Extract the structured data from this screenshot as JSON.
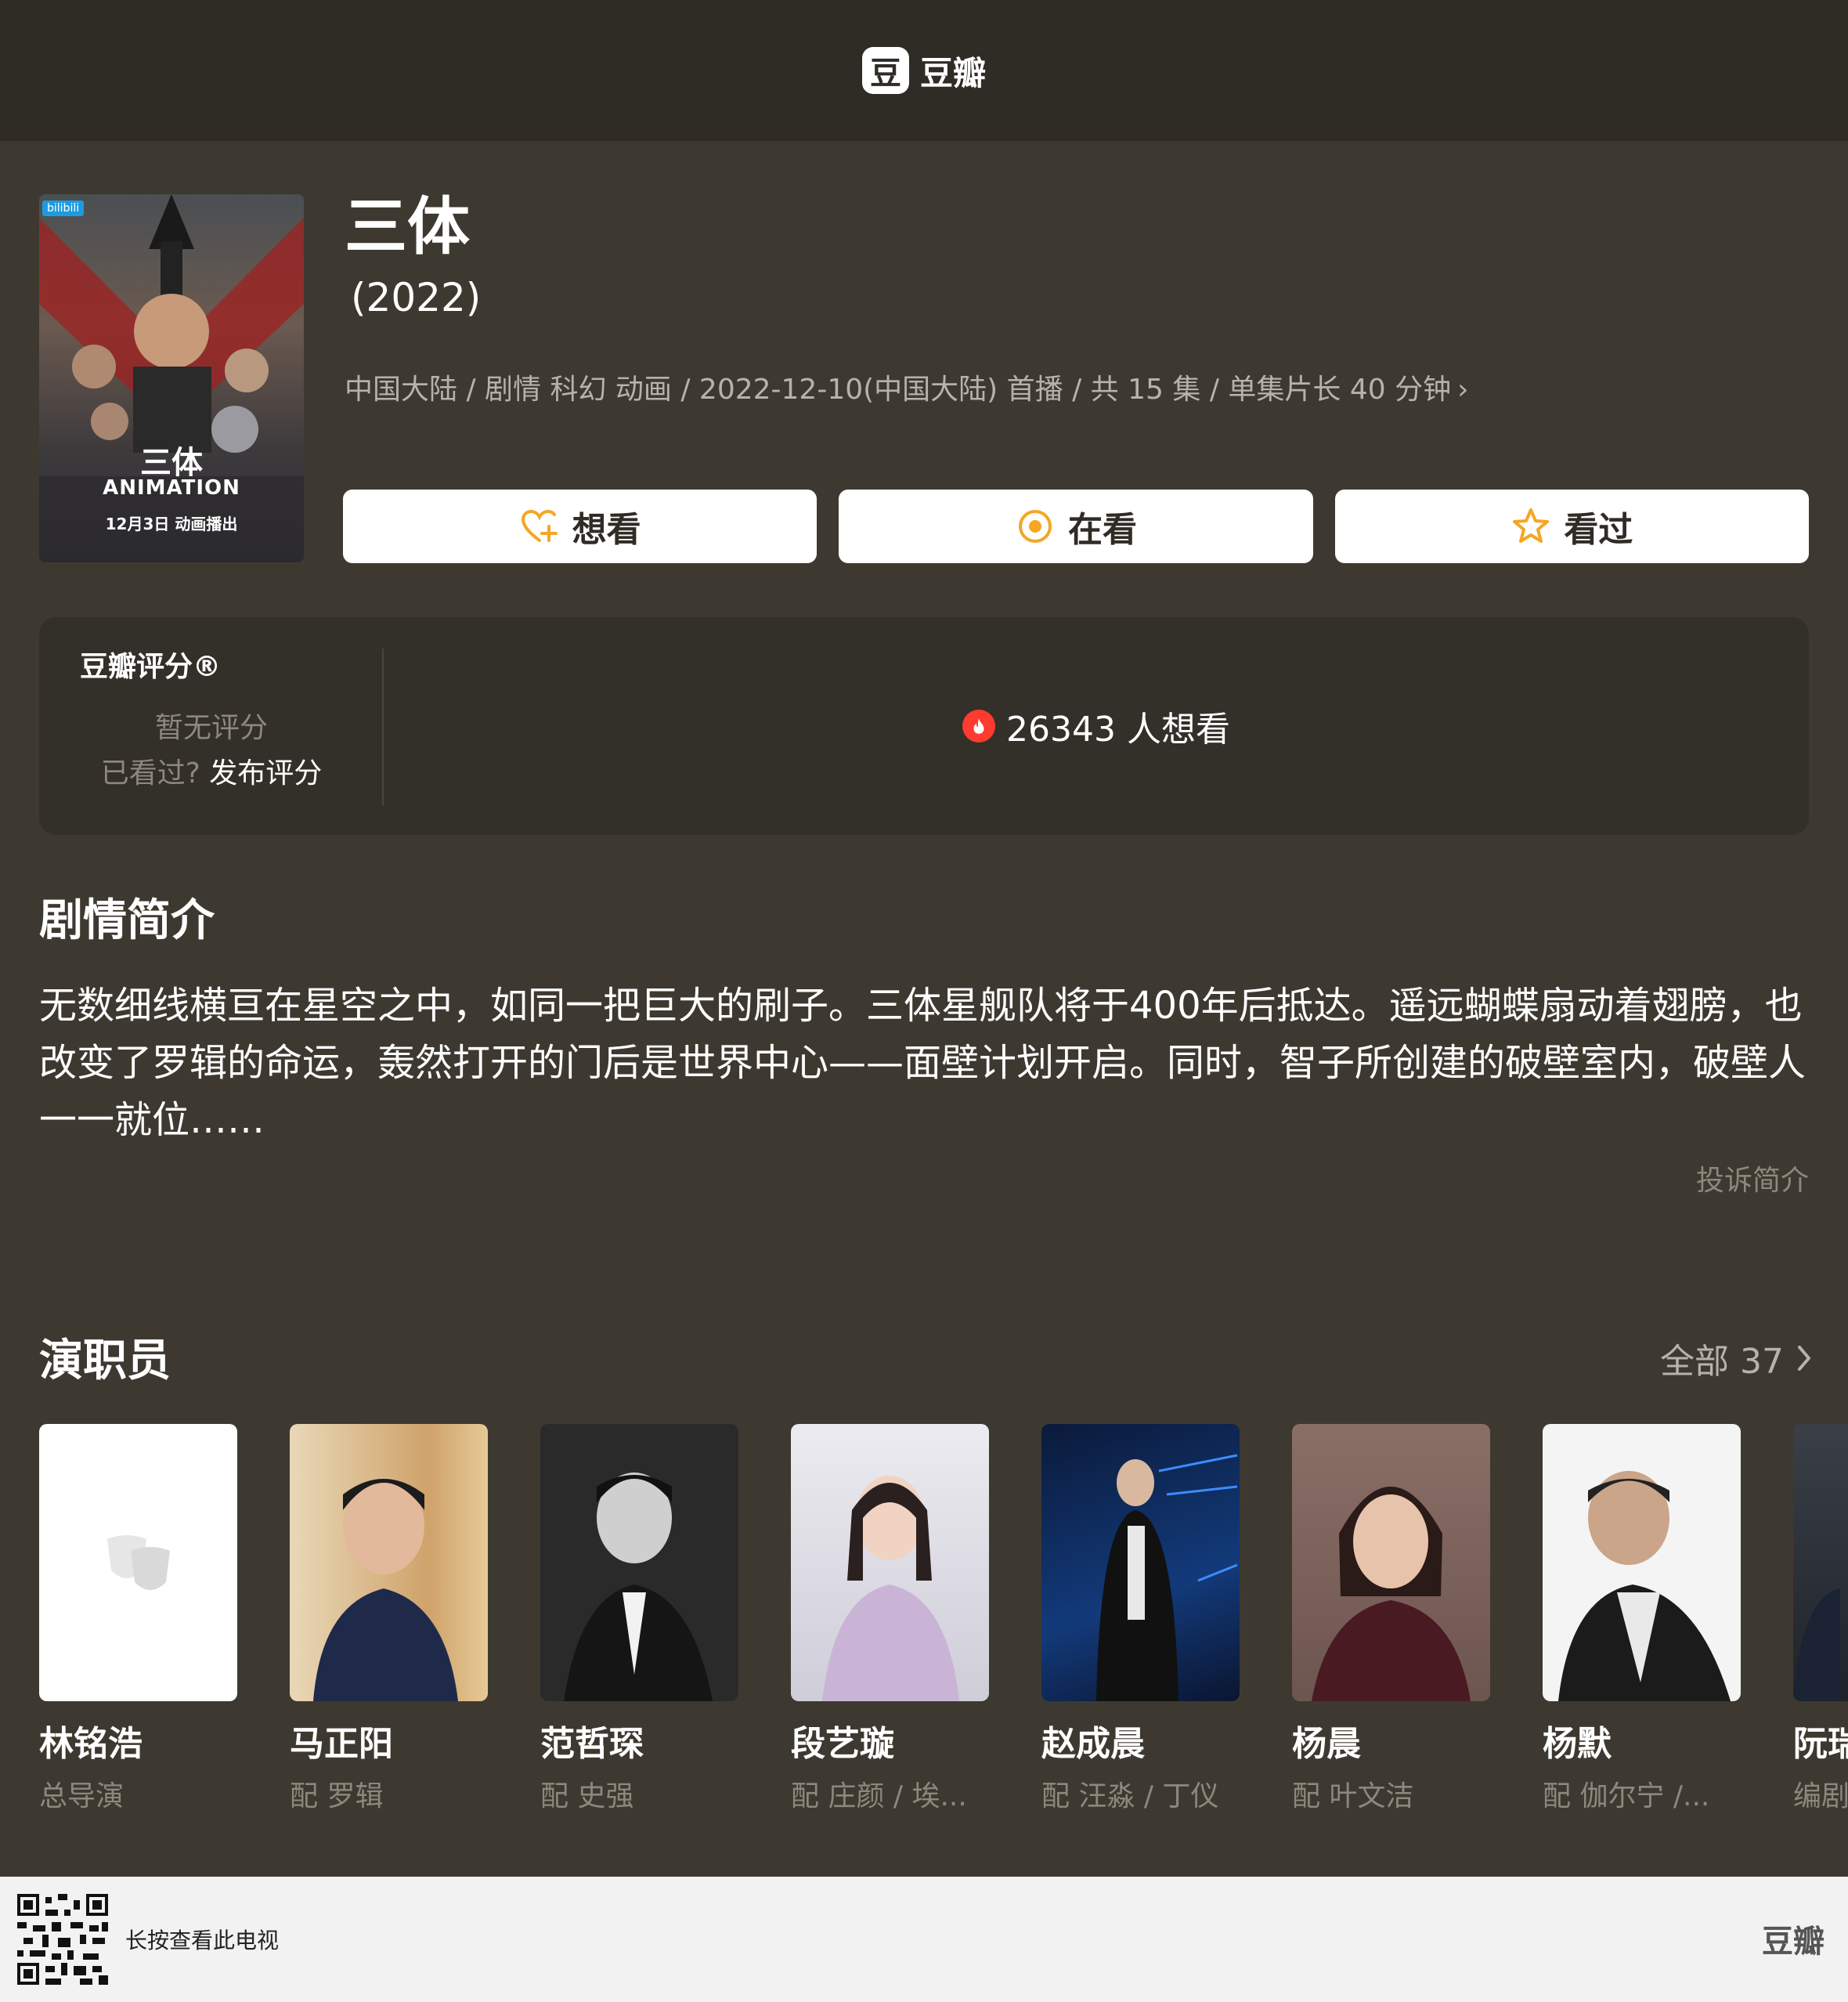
{
  "header": {
    "logo_mark": "豆",
    "logo_text": "豆瓣"
  },
  "poster": {
    "badge": "bilibili",
    "title": "三体",
    "subtitle": "ANIMATION",
    "date": "12月3日 动画播出"
  },
  "show": {
    "title": "三体",
    "year": "(2022)",
    "meta": "中国大陆 / 剧情 科幻 动画 / 2022-12-10(中国大陆) 首播 / 共 15 集 / 单集片长 40 分钟"
  },
  "actions": [
    {
      "label": "想看",
      "icon": "heart-plus-icon",
      "color": "#f5a623"
    },
    {
      "label": "在看",
      "icon": "target-icon",
      "color": "#f5a623"
    },
    {
      "label": "看过",
      "icon": "star-icon",
      "color": "#f5a623"
    }
  ],
  "rating": {
    "label": "豆瓣评分®",
    "none": "暂无评分",
    "prompt": "已看过?",
    "link": "发布评分",
    "wish_count": "26343 人想看",
    "flame_color": "#ff3b30"
  },
  "synopsis": {
    "title": "剧情简介",
    "text": "无数细线横亘在星空之中，如同一把巨大的刷子。三体星舰队将于400年后抵达。遥远蝴蝶扇动着翅膀，也改变了罗辑的命运，轰然打开的门后是世界中心——面壁计划开启。同时，智子所创建的破壁室内，破壁人一一就位……",
    "report": "投诉简介"
  },
  "cast": {
    "title": "演职员",
    "see_all": "全部 37",
    "items": [
      {
        "name": "林铭浩",
        "role": "总导演"
      },
      {
        "name": "马正阳",
        "role": "配 罗辑"
      },
      {
        "name": "范哲琛",
        "role": "配 史强"
      },
      {
        "name": "段艺璇",
        "role": "配 庄颜 / 埃..."
      },
      {
        "name": "赵成晨",
        "role": "配 汪淼 / 丁仪"
      },
      {
        "name": "杨晨",
        "role": "配 叶文洁"
      },
      {
        "name": "杨默",
        "role": "配 伽尔宁 /..."
      },
      {
        "name": "阮瑞",
        "role": "编剧"
      }
    ]
  },
  "footer": {
    "text": "长按查看此电视",
    "logo": "豆瓣"
  }
}
